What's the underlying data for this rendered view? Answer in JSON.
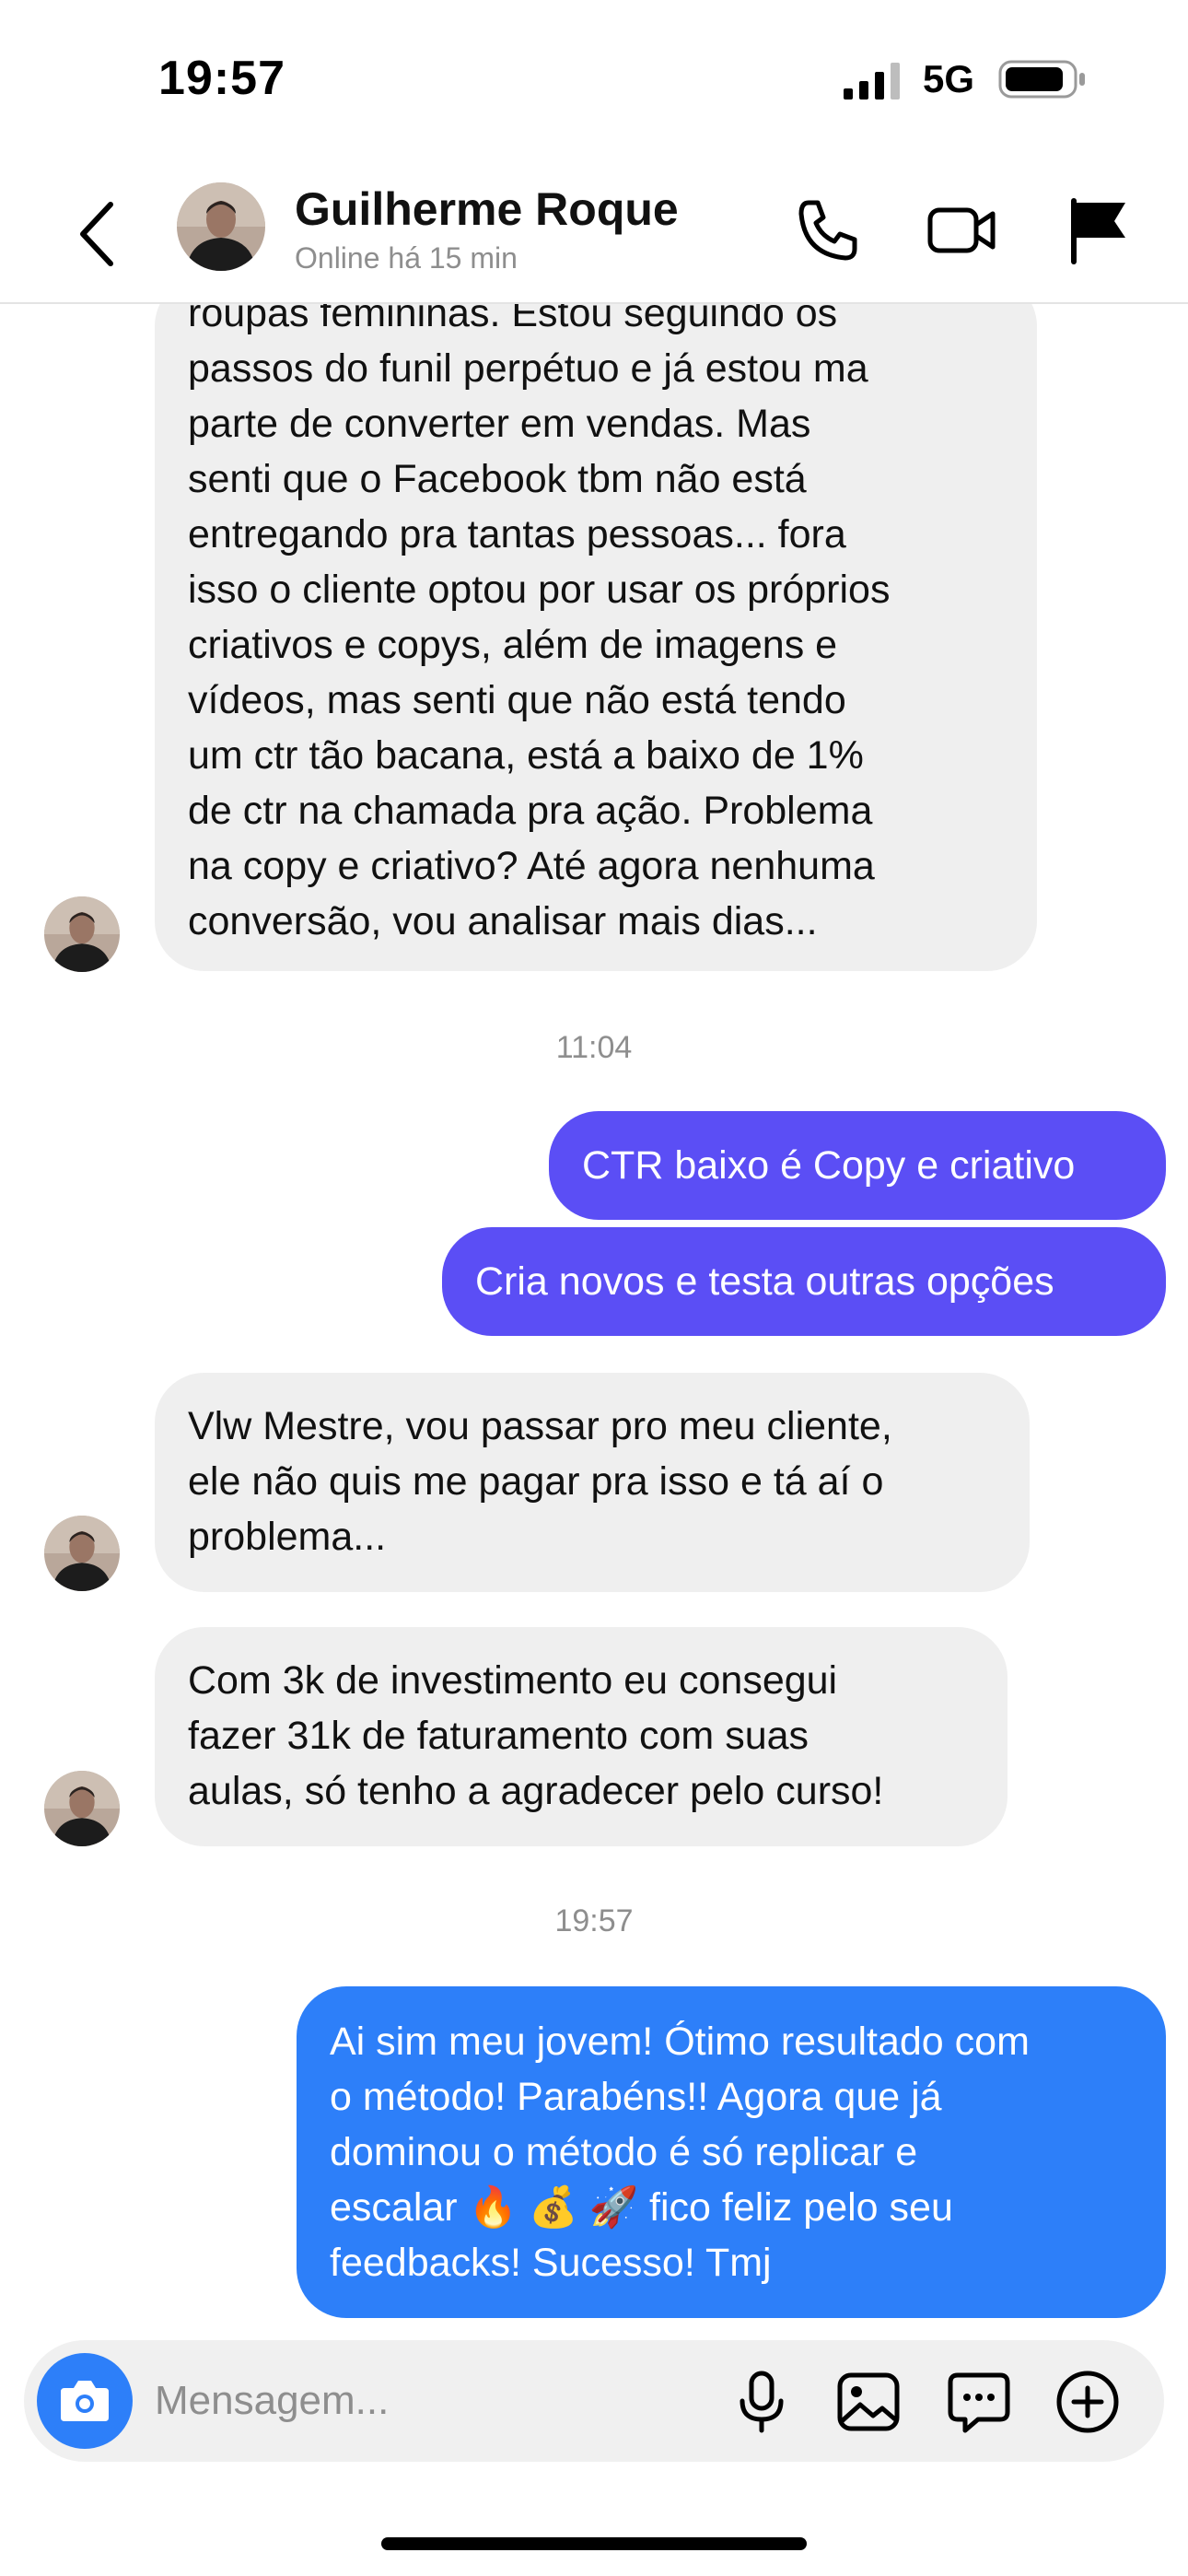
{
  "status_bar": {
    "time": "19:57",
    "network": "5G"
  },
  "header": {
    "name": "Guilherme Roque",
    "status": "Online há 15 min",
    "icons": [
      "back-icon",
      "phone-icon",
      "video-camera-icon",
      "flag-icon"
    ]
  },
  "messages": [
    {
      "direction": "incoming",
      "lines": [
        "roupas femininas. Estou seguindo os",
        "passos do funil perpétuo e já estou ma",
        "parte de converter em vendas. Mas",
        "senti que o Facebook tbm não está",
        "entregando pra tantas pessoas... fora",
        "isso o cliente optou por usar os próprios",
        "criativos e copys, além de imagens e",
        "vídeos, mas senti que não está tendo",
        "um ctr tão bacana, está a baixo de 1%",
        "de ctr na chamada pra ação. Problema",
        "na copy e criativo? Até agora nenhuma",
        "conversão, vou analisar mais dias..."
      ]
    },
    {
      "timestamp": "11:04"
    },
    {
      "direction": "outgoing",
      "lines": [
        "CTR baixo é Copy e criativo"
      ]
    },
    {
      "direction": "outgoing",
      "lines": [
        "Cria novos e testa outras opções"
      ]
    },
    {
      "direction": "incoming",
      "lines": [
        "Vlw Mestre, vou passar pro meu cliente,",
        "ele não quis me pagar pra isso e tá aí o",
        "problema..."
      ]
    },
    {
      "direction": "incoming",
      "lines": [
        "Com 3k de investimento eu consegui",
        "fazer 31k de faturamento com suas",
        "aulas, só tenho a agradecer pelo curso!"
      ]
    },
    {
      "timestamp": "19:57"
    },
    {
      "direction": "outgoing",
      "lines": [
        "Ai sim meu jovem! Ótimo resultado com",
        "o método! Parabéns!! Agora que já",
        "dominou o método é só replicar e",
        "escalar 🔥 💰 🚀  fico feliz pelo seu",
        "feedbacks! Sucesso! Tmj"
      ]
    }
  ],
  "composer": {
    "placeholder": "Mensagem...",
    "icons": [
      "camera-icon",
      "microphone-icon",
      "gallery-icon",
      "sticker-icon",
      "plus-icon"
    ]
  },
  "colors": {
    "incoming_bubble": "#efefef",
    "outgoing_purple": "#5b4ef5",
    "outgoing_blue": "#2d7ff9",
    "muted_text": "#8e8e8e"
  }
}
